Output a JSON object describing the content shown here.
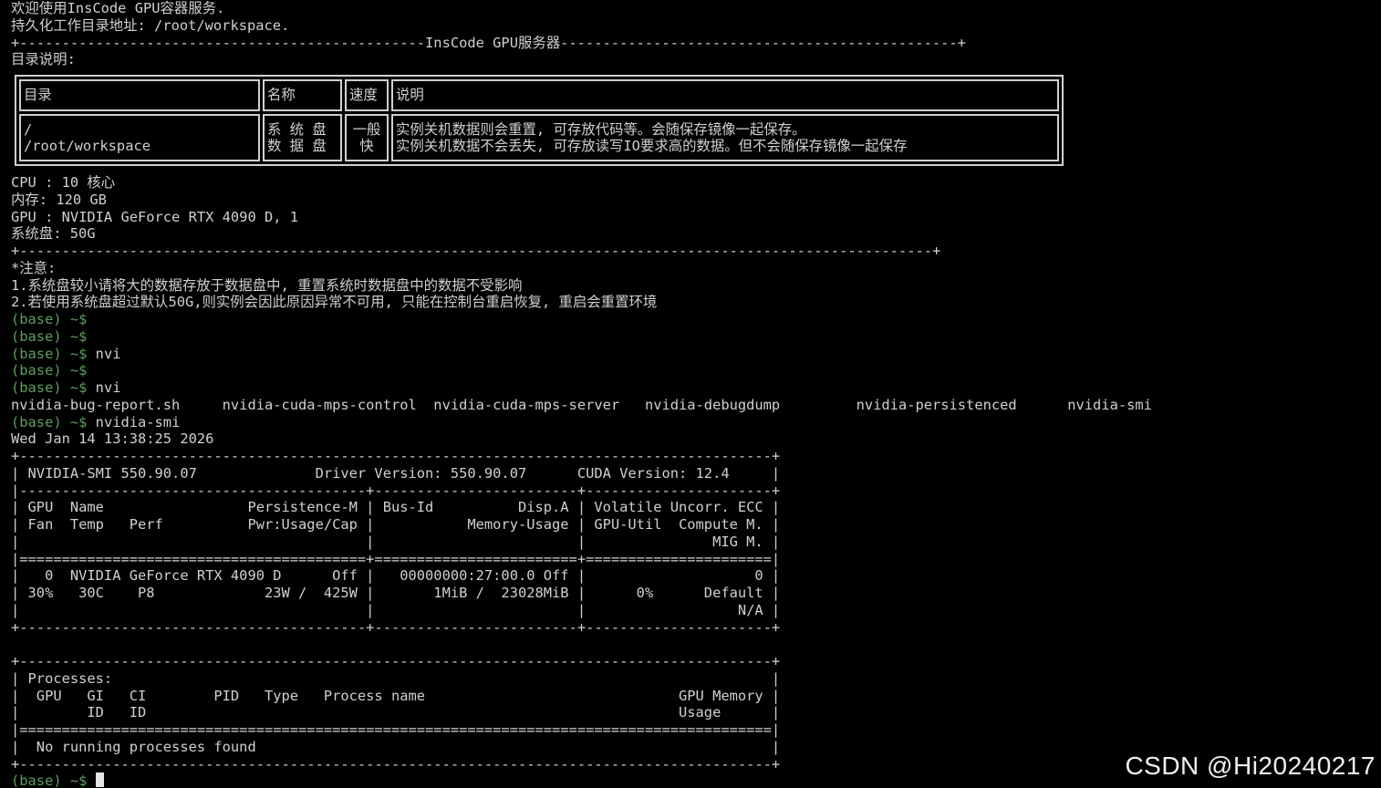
{
  "terminal": {
    "header_lines": [
      "欢迎使用InsCode GPU容器服务.",
      "持久化工作目录地址: /root/workspace.",
      "+------------------------------------------------InsCode GPU服务器-----------------------------------------------+",
      "目录说明:"
    ],
    "dir_table": {
      "headers": [
        "目录",
        "名称",
        "速度",
        "说明"
      ],
      "rows": [
        {
          "dir": "/\n/root/workspace",
          "name": "系 统 盘\n数 据 盘",
          "speed": "一般\n快",
          "desc": "实例关机数据则会重置, 可存放代码等。会随保存镜像一起保存。\n实例关机数据不会丢失, 可存放读写IO要求高的数据。但不会随保存镜像一起保存"
        }
      ]
    },
    "info_lines": [
      "CPU : 10 核心",
      "内存: 120 GB",
      "GPU : NVIDIA GeForce RTX 4090 D, 1",
      "系统盘: 50G",
      "+------------------------------------------------------------------------------------------------------------+",
      "*注意:",
      "1.系统盘较小请将大的数据存放于数据盘中, 重置系统时数据盘中的数据不受影响",
      "2.若使用系统盘超过默认50G,则实例会因此原因异常不可用, 只能在控制台重启恢复, 重启会重置环境"
    ],
    "prompt_label": "(base) ~$",
    "session": [
      {
        "type": "prompt",
        "cmd": ""
      },
      {
        "type": "prompt",
        "cmd": ""
      },
      {
        "type": "prompt",
        "cmd": " nvi"
      },
      {
        "type": "prompt",
        "cmd": ""
      },
      {
        "type": "prompt",
        "cmd": " nvi"
      },
      {
        "type": "output",
        "text": "nvidia-bug-report.sh     nvidia-cuda-mps-control  nvidia-cuda-mps-server   nvidia-debugdump         nvidia-persistenced      nvidia-smi"
      },
      {
        "type": "prompt",
        "cmd": " nvidia-smi"
      },
      {
        "type": "output",
        "text": "Wed Jan 14 13:38:25 2026"
      },
      {
        "type": "output",
        "text": "+-----------------------------------------------------------------------------------------+"
      },
      {
        "type": "output",
        "text": "| NVIDIA-SMI 550.90.07              Driver Version: 550.90.07      CUDA Version: 12.4     |"
      },
      {
        "type": "output",
        "text": "|-----------------------------------------+------------------------+----------------------+"
      },
      {
        "type": "output",
        "text": "| GPU  Name                 Persistence-M | Bus-Id          Disp.A | Volatile Uncorr. ECC |"
      },
      {
        "type": "output",
        "text": "| Fan  Temp   Perf          Pwr:Usage/Cap |           Memory-Usage | GPU-Util  Compute M. |"
      },
      {
        "type": "output",
        "text": "|                                         |                        |               MIG M. |"
      },
      {
        "type": "output",
        "text": "|=========================================+========================+======================|"
      },
      {
        "type": "output",
        "text": "|   0  NVIDIA GeForce RTX 4090 D      Off |   00000000:27:00.0 Off |                    0 |"
      },
      {
        "type": "output",
        "text": "| 30%   30C    P8             23W /  425W |       1MiB /  23028MiB |      0%      Default |"
      },
      {
        "type": "output",
        "text": "|                                         |                        |                  N/A |"
      },
      {
        "type": "output",
        "text": "+-----------------------------------------+------------------------+----------------------+"
      },
      {
        "type": "output",
        "text": ""
      },
      {
        "type": "output",
        "text": "+-----------------------------------------------------------------------------------------+"
      },
      {
        "type": "output",
        "text": "| Processes:                                                                              |"
      },
      {
        "type": "output",
        "text": "|  GPU   GI   CI        PID   Type   Process name                              GPU Memory |"
      },
      {
        "type": "output",
        "text": "|        ID   ID                                                               Usage      |"
      },
      {
        "type": "output",
        "text": "|=========================================================================================|"
      },
      {
        "type": "output",
        "text": "|  No running processes found                                                             |"
      },
      {
        "type": "output",
        "text": "+-----------------------------------------------------------------------------------------+"
      },
      {
        "type": "prompt",
        "cmd": " ",
        "cursor": true
      }
    ]
  },
  "watermark": "CSDN @Hi20240217",
  "colors": {
    "background": "#000000",
    "foreground": "#d0d0d0",
    "prompt": "#5f9e5f"
  }
}
